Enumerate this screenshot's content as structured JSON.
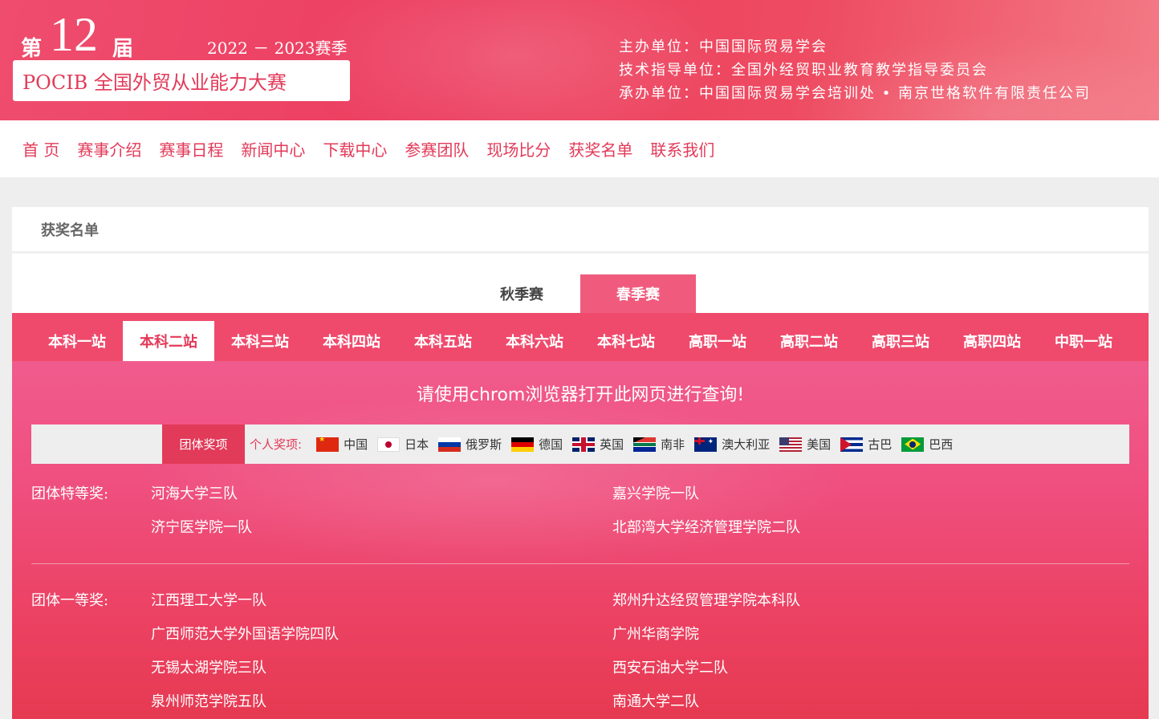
{
  "banner": {
    "edition_prefix": "第",
    "edition_number": "12",
    "edition_suffix": "届",
    "season": "2022 － 2023赛季",
    "competition_name": "POCIB 全国外贸从业能力大赛",
    "organizers": [
      "主办单位：中国国际贸易学会",
      "技术指导单位：全国外经贸职业教育教学指导委员会",
      "承办单位：中国国际贸易学会培训处 • 南京世格软件有限责任公司"
    ]
  },
  "nav": {
    "items": [
      "首 页",
      "赛事介绍",
      "赛事日程",
      "新闻中心",
      "下载中心",
      "参赛团队",
      "现场比分",
      "获奖名单",
      "联系我们"
    ]
  },
  "page": {
    "title": "获奖名单"
  },
  "season_tabs": {
    "autumn": "秋季赛",
    "spring": "春季赛",
    "active": "spring"
  },
  "stations": {
    "items": [
      "本科一站",
      "本科二站",
      "本科三站",
      "本科四站",
      "本科五站",
      "本科六站",
      "本科七站",
      "高职一站",
      "高职二站",
      "高职三站",
      "高职四站",
      "中职一站"
    ],
    "active_index": 1
  },
  "notice": "请使用chrom浏览器打开此网页进行查询!",
  "filters": {
    "team_tab": "团体奖项",
    "individual_label": "个人奖项:",
    "countries": [
      {
        "name": "中国",
        "icon": "china-flag-icon"
      },
      {
        "name": "日本",
        "icon": "japan-flag-icon"
      },
      {
        "name": "俄罗斯",
        "icon": "russia-flag-icon"
      },
      {
        "name": "德国",
        "icon": "germany-flag-icon"
      },
      {
        "name": "英国",
        "icon": "uk-flag-icon"
      },
      {
        "name": "南非",
        "icon": "south-africa-flag-icon"
      },
      {
        "name": "澳大利亚",
        "icon": "australia-flag-icon"
      },
      {
        "name": "美国",
        "icon": "usa-flag-icon"
      },
      {
        "name": "古巴",
        "icon": "cuba-flag-icon"
      },
      {
        "name": "巴西",
        "icon": "brazil-flag-icon"
      }
    ]
  },
  "awards": {
    "special": {
      "label": "团体特等奖:",
      "teams": [
        "河海大学三队",
        "嘉兴学院一队",
        "济宁医学院一队",
        "北部湾大学经济管理学院二队"
      ]
    },
    "first": {
      "label": "团体一等奖:",
      "teams": [
        "江西理工大学一队",
        "郑州升达经贸管理学院本科队",
        "广西师范大学外国语学院四队",
        "广州华商学院",
        "无锡太湖学院三队",
        "西安石油大学二队",
        "泉州师范学院五队",
        "南通大学二队"
      ]
    }
  },
  "colors": {
    "brand": "#e23a59",
    "station_bar": "#ef4a6c",
    "spring_tab": "#f05b7d"
  }
}
